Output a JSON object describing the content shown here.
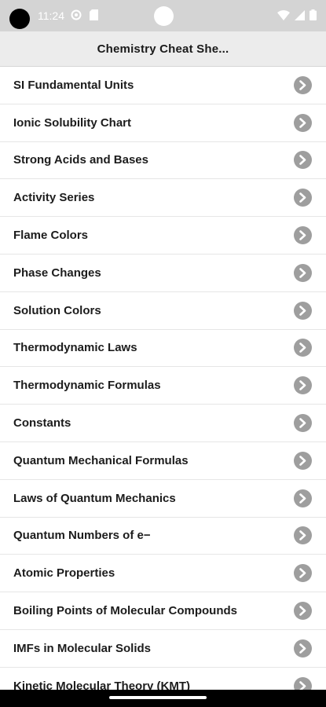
{
  "status_bar": {
    "time": "11:24",
    "icons": [
      "camera-dot",
      "settings-icon",
      "sim-icon",
      "wifi-icon",
      "signal-icon",
      "battery-icon"
    ]
  },
  "app_bar": {
    "title": "Chemistry Cheat She..."
  },
  "list": {
    "items": [
      {
        "label": "SI Fundamental Units"
      },
      {
        "label": "Ionic Solubility Chart"
      },
      {
        "label": "Strong Acids and Bases"
      },
      {
        "label": "Activity Series"
      },
      {
        "label": "Flame Colors"
      },
      {
        "label": "Phase Changes"
      },
      {
        "label": "Solution Colors"
      },
      {
        "label": "Thermodynamic Laws"
      },
      {
        "label": "Thermodynamic Formulas"
      },
      {
        "label": "Constants"
      },
      {
        "label": "Quantum Mechanical Formulas"
      },
      {
        "label": "Laws of Quantum Mechanics"
      },
      {
        "label": "Quantum Numbers of e−"
      },
      {
        "label": "Atomic Properties"
      },
      {
        "label": "Boiling Points of Molecular Compounds"
      },
      {
        "label": "IMFs in Molecular Solids"
      },
      {
        "label": "Kinetic Molecular Theory (KMT)"
      }
    ]
  },
  "colors": {
    "status_bar_bg": "#d4d4d4",
    "app_bar_bg": "#ececec",
    "chevron_bg": "#9e9e9e"
  }
}
